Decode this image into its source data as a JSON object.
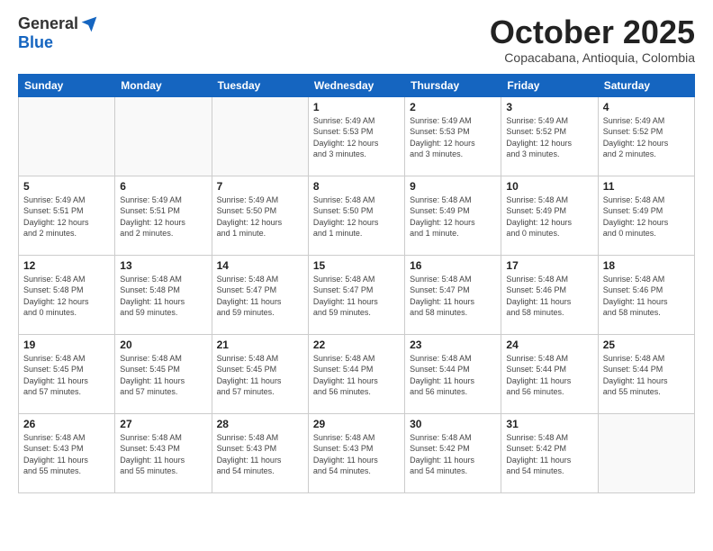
{
  "logo": {
    "general": "General",
    "blue": "Blue"
  },
  "title": "October 2025",
  "subtitle": "Copacabana, Antioquia, Colombia",
  "headers": [
    "Sunday",
    "Monday",
    "Tuesday",
    "Wednesday",
    "Thursday",
    "Friday",
    "Saturday"
  ],
  "weeks": [
    [
      {
        "day": "",
        "info": ""
      },
      {
        "day": "",
        "info": ""
      },
      {
        "day": "",
        "info": ""
      },
      {
        "day": "1",
        "info": "Sunrise: 5:49 AM\nSunset: 5:53 PM\nDaylight: 12 hours\nand 3 minutes."
      },
      {
        "day": "2",
        "info": "Sunrise: 5:49 AM\nSunset: 5:53 PM\nDaylight: 12 hours\nand 3 minutes."
      },
      {
        "day": "3",
        "info": "Sunrise: 5:49 AM\nSunset: 5:52 PM\nDaylight: 12 hours\nand 3 minutes."
      },
      {
        "day": "4",
        "info": "Sunrise: 5:49 AM\nSunset: 5:52 PM\nDaylight: 12 hours\nand 2 minutes."
      }
    ],
    [
      {
        "day": "5",
        "info": "Sunrise: 5:49 AM\nSunset: 5:51 PM\nDaylight: 12 hours\nand 2 minutes."
      },
      {
        "day": "6",
        "info": "Sunrise: 5:49 AM\nSunset: 5:51 PM\nDaylight: 12 hours\nand 2 minutes."
      },
      {
        "day": "7",
        "info": "Sunrise: 5:49 AM\nSunset: 5:50 PM\nDaylight: 12 hours\nand 1 minute."
      },
      {
        "day": "8",
        "info": "Sunrise: 5:48 AM\nSunset: 5:50 PM\nDaylight: 12 hours\nand 1 minute."
      },
      {
        "day": "9",
        "info": "Sunrise: 5:48 AM\nSunset: 5:49 PM\nDaylight: 12 hours\nand 1 minute."
      },
      {
        "day": "10",
        "info": "Sunrise: 5:48 AM\nSunset: 5:49 PM\nDaylight: 12 hours\nand 0 minutes."
      },
      {
        "day": "11",
        "info": "Sunrise: 5:48 AM\nSunset: 5:49 PM\nDaylight: 12 hours\nand 0 minutes."
      }
    ],
    [
      {
        "day": "12",
        "info": "Sunrise: 5:48 AM\nSunset: 5:48 PM\nDaylight: 12 hours\nand 0 minutes."
      },
      {
        "day": "13",
        "info": "Sunrise: 5:48 AM\nSunset: 5:48 PM\nDaylight: 11 hours\nand 59 minutes."
      },
      {
        "day": "14",
        "info": "Sunrise: 5:48 AM\nSunset: 5:47 PM\nDaylight: 11 hours\nand 59 minutes."
      },
      {
        "day": "15",
        "info": "Sunrise: 5:48 AM\nSunset: 5:47 PM\nDaylight: 11 hours\nand 59 minutes."
      },
      {
        "day": "16",
        "info": "Sunrise: 5:48 AM\nSunset: 5:47 PM\nDaylight: 11 hours\nand 58 minutes."
      },
      {
        "day": "17",
        "info": "Sunrise: 5:48 AM\nSunset: 5:46 PM\nDaylight: 11 hours\nand 58 minutes."
      },
      {
        "day": "18",
        "info": "Sunrise: 5:48 AM\nSunset: 5:46 PM\nDaylight: 11 hours\nand 58 minutes."
      }
    ],
    [
      {
        "day": "19",
        "info": "Sunrise: 5:48 AM\nSunset: 5:45 PM\nDaylight: 11 hours\nand 57 minutes."
      },
      {
        "day": "20",
        "info": "Sunrise: 5:48 AM\nSunset: 5:45 PM\nDaylight: 11 hours\nand 57 minutes."
      },
      {
        "day": "21",
        "info": "Sunrise: 5:48 AM\nSunset: 5:45 PM\nDaylight: 11 hours\nand 57 minutes."
      },
      {
        "day": "22",
        "info": "Sunrise: 5:48 AM\nSunset: 5:44 PM\nDaylight: 11 hours\nand 56 minutes."
      },
      {
        "day": "23",
        "info": "Sunrise: 5:48 AM\nSunset: 5:44 PM\nDaylight: 11 hours\nand 56 minutes."
      },
      {
        "day": "24",
        "info": "Sunrise: 5:48 AM\nSunset: 5:44 PM\nDaylight: 11 hours\nand 56 minutes."
      },
      {
        "day": "25",
        "info": "Sunrise: 5:48 AM\nSunset: 5:44 PM\nDaylight: 11 hours\nand 55 minutes."
      }
    ],
    [
      {
        "day": "26",
        "info": "Sunrise: 5:48 AM\nSunset: 5:43 PM\nDaylight: 11 hours\nand 55 minutes."
      },
      {
        "day": "27",
        "info": "Sunrise: 5:48 AM\nSunset: 5:43 PM\nDaylight: 11 hours\nand 55 minutes."
      },
      {
        "day": "28",
        "info": "Sunrise: 5:48 AM\nSunset: 5:43 PM\nDaylight: 11 hours\nand 54 minutes."
      },
      {
        "day": "29",
        "info": "Sunrise: 5:48 AM\nSunset: 5:43 PM\nDaylight: 11 hours\nand 54 minutes."
      },
      {
        "day": "30",
        "info": "Sunrise: 5:48 AM\nSunset: 5:42 PM\nDaylight: 11 hours\nand 54 minutes."
      },
      {
        "day": "31",
        "info": "Sunrise: 5:48 AM\nSunset: 5:42 PM\nDaylight: 11 hours\nand 54 minutes."
      },
      {
        "day": "",
        "info": ""
      }
    ]
  ]
}
